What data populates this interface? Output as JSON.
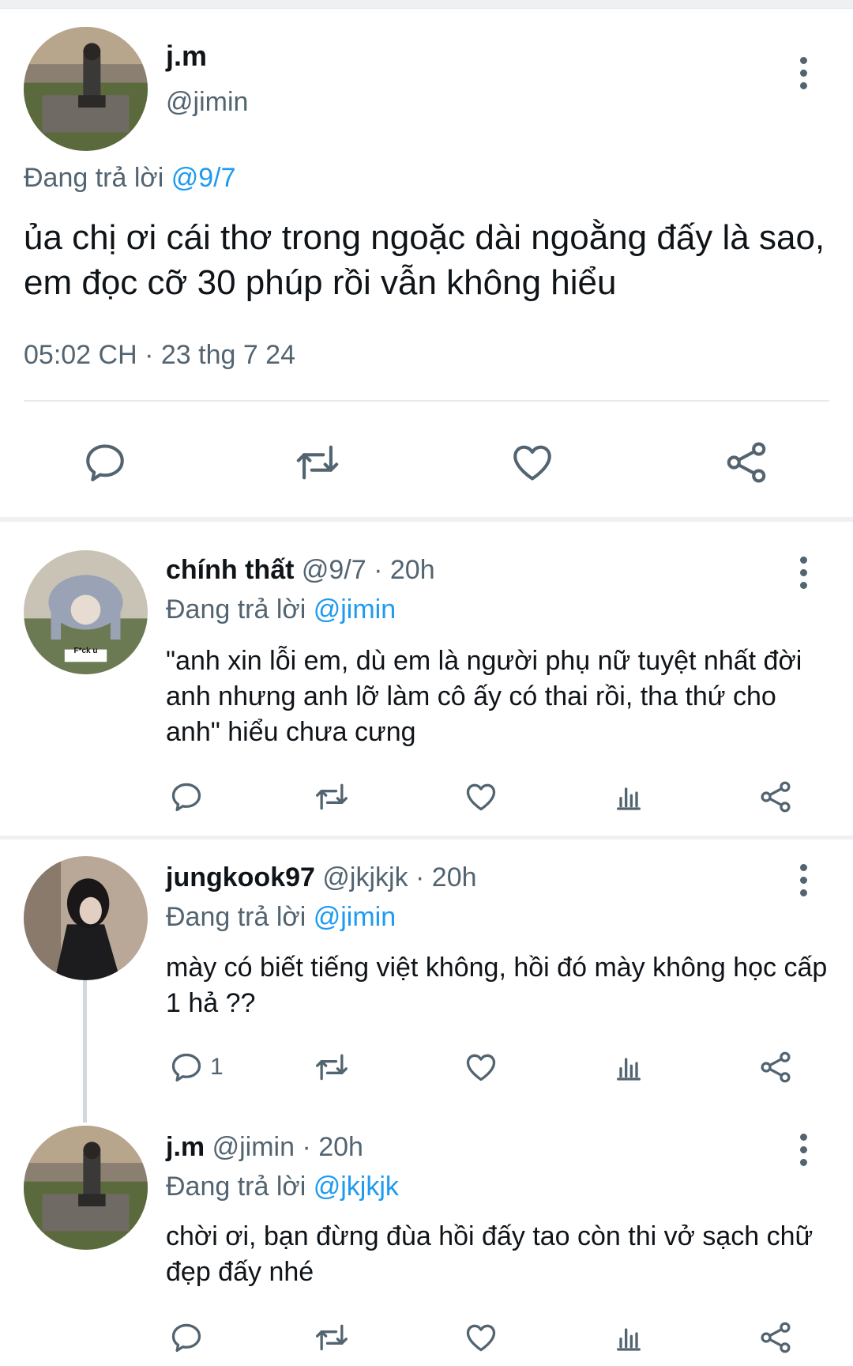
{
  "main_tweet": {
    "name": "j.m",
    "handle": "@jimin",
    "replying_prefix": "Đang trả lời ",
    "replying_to": "@9/7",
    "text": "ủa chị ơi cái thơ trong ngoặc dài ngoằng đấy là sao, em đọc cỡ 30 phúp rồi vẫn không hiểu",
    "timestamp": "05:02 CH · 23 thg 7 24"
  },
  "replies": [
    {
      "name": "chính thất",
      "handle": "@9/7",
      "time": " · 20h",
      "replying_prefix": "Đang trả lời ",
      "replying_to": "@jimin",
      "text": "\"anh xin lỗi em, dù em là người phụ nữ tuyệt nhất đời anh nhưng anh lỡ làm cô ấy có thai rồi, tha thứ cho anh\" hiểu chưa cưng",
      "avatar_caption": "F*ck u",
      "reply_count": ""
    },
    {
      "name": "jungkook97",
      "handle": "@jkjkjk",
      "time": " · 20h",
      "replying_prefix": "Đang trả lời ",
      "replying_to": "@jimin",
      "text": "mày có biết tiếng việt không, hồi đó mày không học cấp 1 hả ??",
      "reply_count": "1"
    },
    {
      "name": "j.m",
      "handle": "@jimin",
      "time": " · 20h",
      "replying_prefix": "Đang trả lời ",
      "replying_to": "@jkjkjk",
      "text": "chời ơi, bạn đừng đùa hồi đấy tao còn thi vở sạch chữ đẹp đấy nhé",
      "reply_count": ""
    }
  ],
  "icons": [
    "reply-icon",
    "retweet-icon",
    "like-icon",
    "views-icon",
    "share-icon",
    "more-icon"
  ],
  "colors": {
    "text": "#0f1419",
    "secondary": "#536471",
    "accent": "#1d9bf0",
    "divider": "#eef0f2"
  }
}
